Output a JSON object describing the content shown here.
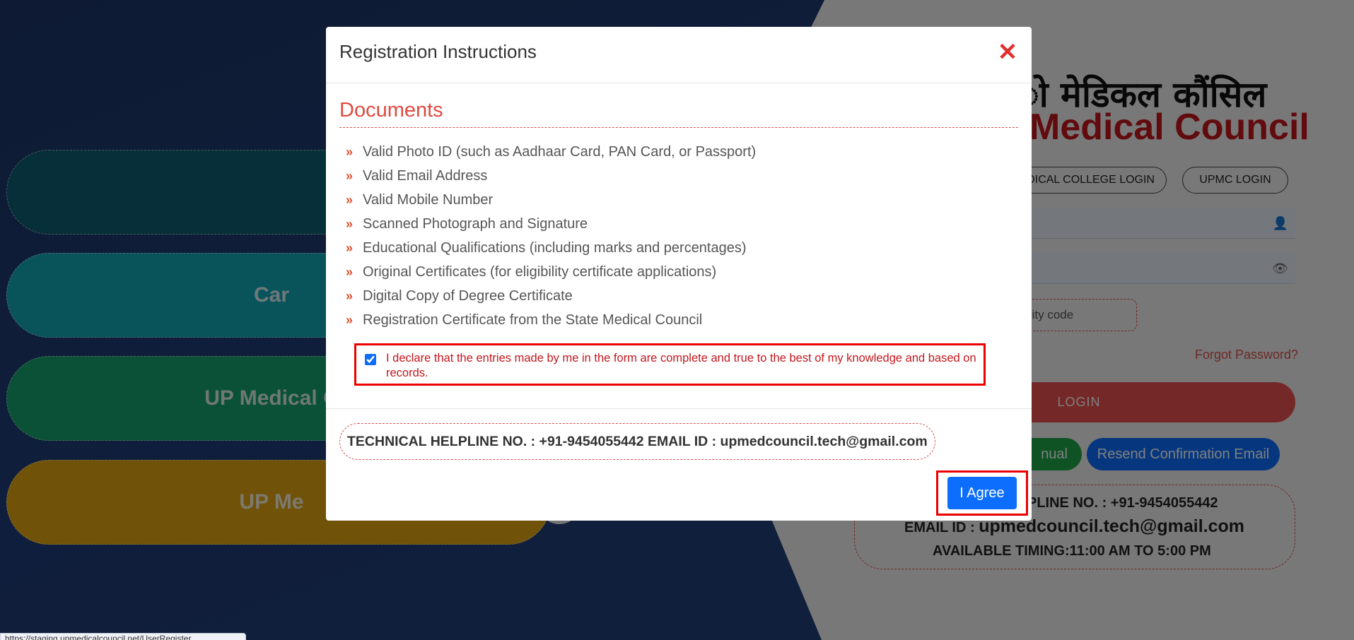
{
  "background": {
    "pills": [
      {
        "label": "",
        "color": "#0c5e72"
      },
      {
        "label": "Car",
        "color": "#12a6b7"
      },
      {
        "label": "UP Medical C",
        "color": "#14a36f"
      },
      {
        "label": "UP Me",
        "color": "#e0a512"
      }
    ],
    "logo_hindi": "ो मेडिकल कौंसिल",
    "logo_english": "Medical Council",
    "college_login_label": "DICAL COLLEGE LOGIN",
    "upmc_login_label": "UPMC LOGIN",
    "security_code_placeholder": "curity code",
    "forgot_password": "Forgot Password?",
    "login_label": "LOGIN",
    "manual_label": "nual",
    "resend_label": "Resend Confirmation Email",
    "help_line1": "PLINE NO. : +91-9454055442",
    "help_email_prefix": "EMAIL ID : ",
    "help_email": "upmedcouncil.tech@gmail.com",
    "help_timing": "AVAILABLE TIMING:11:00 AM TO 5:00 PM"
  },
  "modal": {
    "title": "Registration Instructions",
    "close_symbol": "✕",
    "section_title": "Documents",
    "documents": [
      "Valid Photo ID (such as Aadhaar Card, PAN Card, or Passport)",
      "Valid Email Address",
      "Valid Mobile Number",
      "Scanned Photograph and Signature",
      "Educational Qualifications (including marks and percentages)",
      "Original Certificates (for eligibility certificate applications)",
      "Digital Copy of Degree Certificate",
      "Registration Certificate from the State Medical Council"
    ],
    "declaration_checked": true,
    "declaration_text": "I declare that the entries made by me in the form are complete and true to the best of my knowledge and based on records.",
    "helpline_text": "TECHNICAL HELPLINE NO. : +91-9454055442 EMAIL ID : upmedcouncil.tech@gmail.com",
    "agree_label": "I Agree"
  },
  "status_bar_url": "https://staging.upmedicalcouncil.net/UserRegister"
}
